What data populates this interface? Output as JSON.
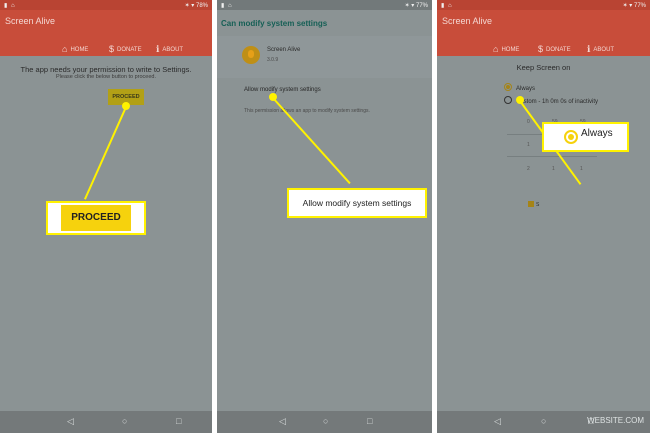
{
  "panel1": {
    "status_icons": "▮ ⌂",
    "status_right": "✶ ▾ 78%",
    "app_title": "Screen Alive",
    "tabs": [
      {
        "icon": "⌂",
        "label": "HOME"
      },
      {
        "icon": "$",
        "label": "DONATE"
      },
      {
        "icon": "ℹ",
        "label": "ABOUT"
      }
    ],
    "message": "The app needs your permission to write to Settings.",
    "sub_message": "Please click the below button to proceed.",
    "proceed_button": "PROCEED",
    "callout_button": "PROCEED"
  },
  "panel2": {
    "status_icons": "▮ ⌂",
    "status_right": "✶ ▾ 77%",
    "header_title": "Can modify system settings",
    "app_name": "Screen Alive",
    "app_version": "3.0.9",
    "allow_label": "Allow modify system settings",
    "allow_desc": "This permission allows an app to modify system settings.",
    "callout_text": "Allow modify system settings"
  },
  "panel3": {
    "status_icons": "▮ ⌂",
    "status_right": "✶ ▾ 77%",
    "app_title": "Screen Alive",
    "tabs": [
      {
        "icon": "⌂",
        "label": "HOME"
      },
      {
        "icon": "$",
        "label": "DONATE"
      },
      {
        "icon": "ℹ",
        "label": "ABOUT"
      }
    ],
    "heading": "Keep Screen on",
    "option_always": "Always",
    "option_custom": "Custom - 1h 0m 0s of inactivity",
    "picker": {
      "row1": [
        "0",
        "59",
        "59"
      ],
      "row2": [
        "1",
        "0",
        "0"
      ],
      "row3": [
        "2",
        "1",
        "1"
      ]
    },
    "checkbox_label": "S",
    "callout_text": "Always"
  },
  "nav": {
    "back": "◁",
    "home": "○",
    "recents": "□"
  },
  "watermark": "WEBSITE.COM",
  "colors": {
    "app_bar": "#c84d3a",
    "callout_yellow": "#fff200",
    "button_yellow": "#f6d20d",
    "overlay_gray": "#8b9394",
    "dialog_title": "#155f55"
  }
}
